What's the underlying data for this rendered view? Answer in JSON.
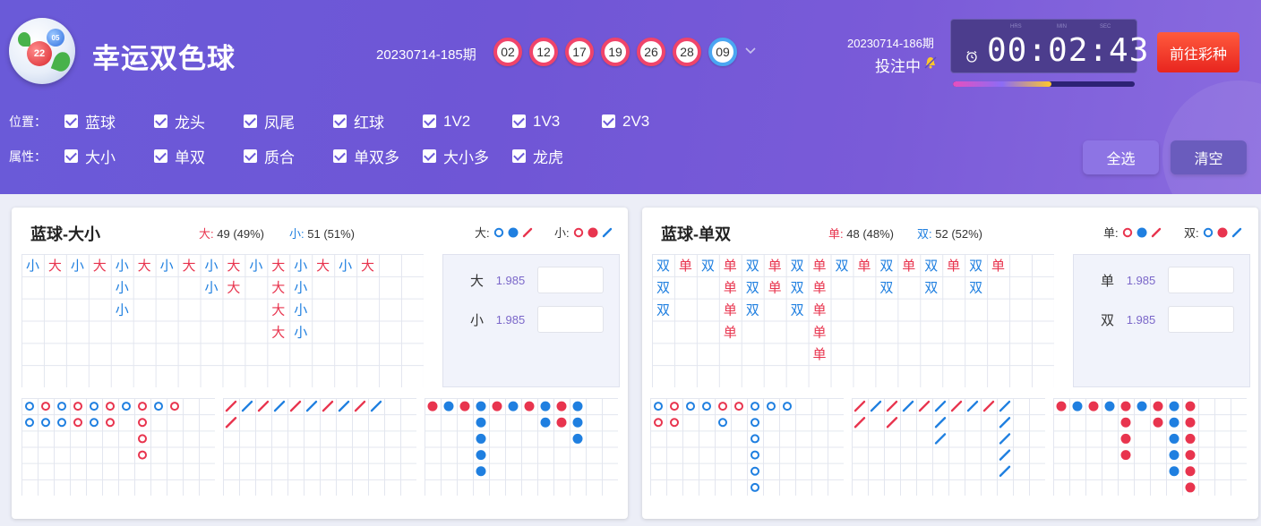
{
  "header": {
    "title": "幸运双色球",
    "logo_ball_big": "22",
    "logo_ball_small": "05",
    "last_period": "20230714-185期",
    "last_numbers": [
      "02",
      "12",
      "17",
      "19",
      "26",
      "28"
    ],
    "last_blue": "09",
    "next_period": "20230714-186期",
    "status": "投注中",
    "timer_labels": [
      "HRS",
      "MIN",
      "SEC"
    ],
    "timer": "00:02:43",
    "timer_progress": 0.54,
    "go_button": "前往彩种",
    "colors": {
      "accent": "#6a5ad8",
      "red_ball": "#f0446a",
      "blue_ball": "#4aa6f2",
      "go": "#e8251f"
    }
  },
  "filters": {
    "position_label": "位置：",
    "positions": [
      "蓝球",
      "龙头",
      "凤尾",
      "红球",
      "1V2",
      "1V3",
      "2V3"
    ],
    "attribute_label": "属性：",
    "attributes": [
      "大小",
      "单双",
      "质合",
      "单双多",
      "大小多",
      "龙虎"
    ],
    "select_all": "全选",
    "clear": "清空"
  },
  "panels": [
    {
      "title": "蓝球-大小",
      "a_label": "大:",
      "a_stat": "49 (49%)",
      "b_label": "小:",
      "b_stat": "51 (51%)",
      "legend_a": "大:",
      "legend_b": "小:",
      "a_char": "大",
      "b_char": "小",
      "road": [
        [
          "小"
        ],
        [
          "大"
        ],
        [
          "小"
        ],
        [
          "大"
        ],
        [
          "小",
          "小",
          "小"
        ],
        [
          "大"
        ],
        [
          "小"
        ],
        [
          "大"
        ],
        [
          "小",
          "小"
        ],
        [
          "大",
          "大"
        ],
        [
          "小"
        ],
        [
          "大",
          "大",
          "大",
          "大"
        ],
        [
          "小",
          "小",
          "小",
          "小"
        ],
        [
          "大"
        ],
        [
          "小"
        ],
        [
          "大"
        ]
      ],
      "bet_rows": [
        {
          "name": "大",
          "odds": "1.985"
        },
        {
          "name": "小",
          "odds": "1.985"
        }
      ],
      "ring_road": [
        [
          "b",
          "b"
        ],
        [
          "r",
          "b"
        ],
        [
          "b",
          "b"
        ],
        [
          "r",
          "r"
        ],
        [
          "b",
          "b"
        ],
        [
          "r",
          "r"
        ],
        [
          "b"
        ],
        [
          "r",
          "r",
          "r",
          "r"
        ],
        [
          "b"
        ],
        [
          "r"
        ]
      ],
      "slash_road": [
        [
          "r",
          "r"
        ],
        [
          "b"
        ],
        [
          "r"
        ],
        [
          "b"
        ],
        [
          "r"
        ],
        [
          "b"
        ],
        [
          "r"
        ],
        [
          "b"
        ],
        [
          "r"
        ],
        [
          "b"
        ]
      ],
      "dot_road": [
        [
          "r"
        ],
        [
          "b"
        ],
        [
          "r"
        ],
        [
          "b",
          "b",
          "b",
          "b",
          "b"
        ],
        [
          "r"
        ],
        [
          "b"
        ],
        [
          "r"
        ],
        [
          "b",
          "b"
        ],
        [
          "r",
          "r"
        ],
        [
          "b",
          "b",
          "b"
        ]
      ]
    },
    {
      "title": "蓝球-单双",
      "a_label": "单:",
      "a_stat": "48 (48%)",
      "b_label": "双:",
      "b_stat": "52 (52%)",
      "legend_a": "单:",
      "legend_b": "双:",
      "a_char": "单",
      "b_char": "双",
      "road": [
        [
          "双",
          "双",
          "双"
        ],
        [
          "单"
        ],
        [
          "双"
        ],
        [
          "单",
          "单",
          "单",
          "单"
        ],
        [
          "双",
          "双",
          "双"
        ],
        [
          "单",
          "单"
        ],
        [
          "双",
          "双",
          "双"
        ],
        [
          "单",
          "单",
          "单",
          "单",
          "单"
        ],
        [
          "双"
        ],
        [
          "单"
        ],
        [
          "双",
          "双"
        ],
        [
          "单"
        ],
        [
          "双",
          "双"
        ],
        [
          "单"
        ],
        [
          "双",
          "双"
        ],
        [
          "单"
        ]
      ],
      "bet_rows": [
        {
          "name": "单",
          "odds": "1.985"
        },
        {
          "name": "双",
          "odds": "1.985"
        }
      ],
      "ring_road": [
        [
          "b",
          "r"
        ],
        [
          "r",
          "r"
        ],
        [
          "b"
        ],
        [
          "b"
        ],
        [
          "r",
          "b"
        ],
        [
          "r"
        ],
        [
          "b",
          "b",
          "b",
          "b",
          "b",
          "b"
        ],
        [
          "b"
        ],
        [
          "b"
        ]
      ],
      "slash_road": [
        [
          "r",
          "r"
        ],
        [
          "b"
        ],
        [
          "r",
          "r"
        ],
        [
          "b"
        ],
        [
          "r"
        ],
        [
          "b",
          "b",
          "b"
        ],
        [
          "r"
        ],
        [
          "b"
        ],
        [
          "r"
        ],
        [
          "b",
          "b",
          "b",
          "b",
          "b"
        ]
      ],
      "dot_road": [
        [
          "r"
        ],
        [
          "b"
        ],
        [
          "r"
        ],
        [
          "b"
        ],
        [
          "r",
          "r",
          "r",
          "r"
        ],
        [
          "b"
        ],
        [
          "r",
          "r"
        ],
        [
          "b",
          "b",
          "b",
          "b",
          "b"
        ],
        [
          "r",
          "r",
          "r",
          "r",
          "r",
          "r"
        ]
      ]
    }
  ]
}
